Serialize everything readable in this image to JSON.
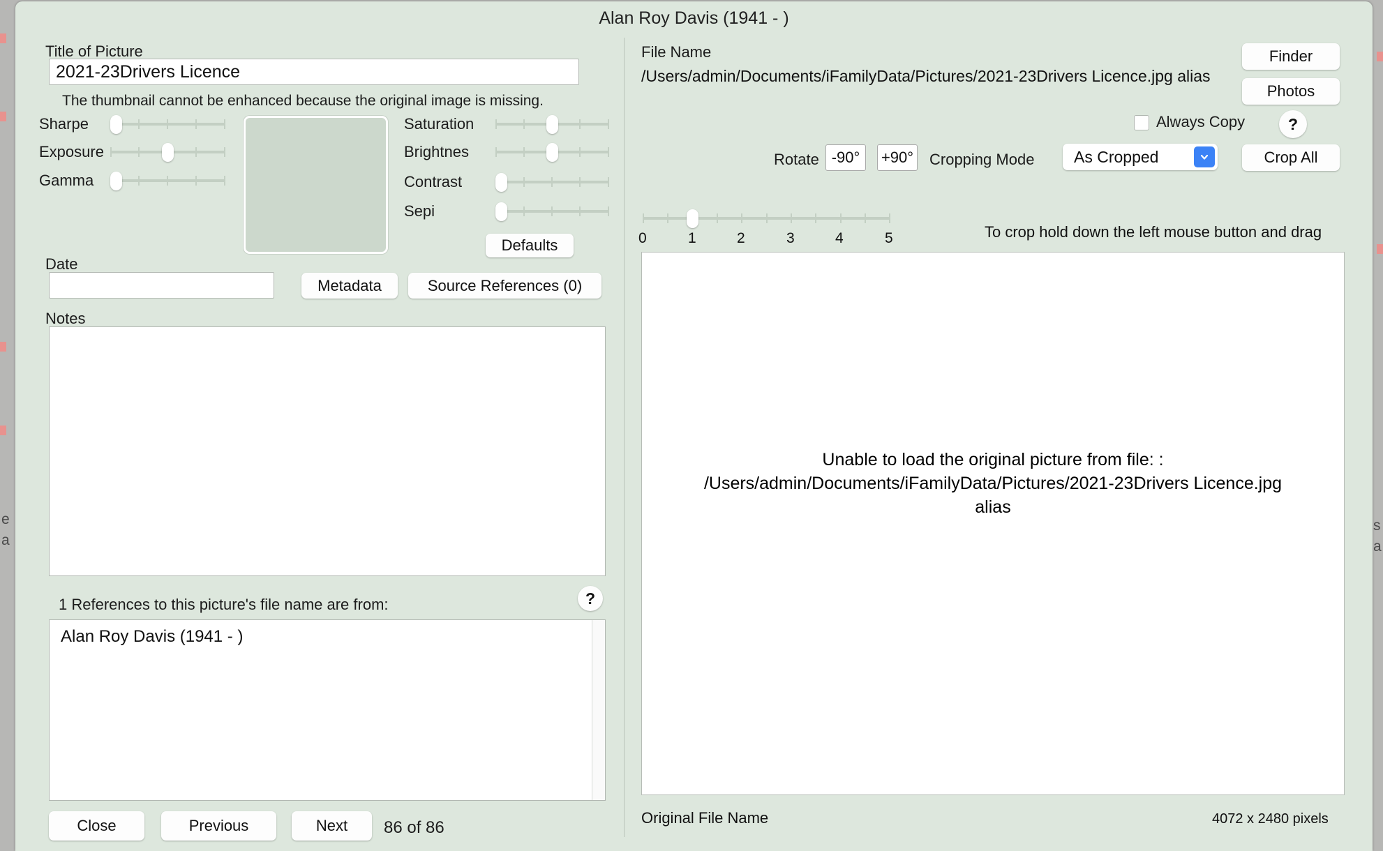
{
  "window": {
    "title": "Alan Roy Davis (1941 - )"
  },
  "background": {
    "snippet1": "e",
    "snippet2": "a",
    "snippet3": "s",
    "snippet4": "a"
  },
  "left": {
    "title_label": "Title of Picture",
    "title_value": "2021-23Drivers Licence",
    "thumbnail_hint": "The thumbnail cannot be enhanced because the original image is missing.",
    "sliders_left": [
      {
        "label": "Sharpe",
        "value": 0
      },
      {
        "label": "Exposure",
        "value": 0.5
      },
      {
        "label": "Gamma",
        "value": 0
      }
    ],
    "sliders_right": [
      {
        "label": "Saturation",
        "value": 0.5
      },
      {
        "label": "Brightnes",
        "value": 0.5
      },
      {
        "label": "Contrast",
        "value": 0
      },
      {
        "label": "Sepi",
        "value": 0
      }
    ],
    "defaults_button": "Defaults",
    "date_label": "Date",
    "date_value": "",
    "metadata_button": "Metadata",
    "source_references_button": "Source References (0)",
    "notes_label": "Notes",
    "notes_value": "",
    "references_label": "1 References to this picture's file name are from:",
    "references_help": "?",
    "references_items": [
      "Alan Roy Davis (1941 - )"
    ],
    "close_button": "Close",
    "previous_button": "Previous",
    "next_button": "Next",
    "counter": "86 of 86"
  },
  "right": {
    "file_name_label": "File Name",
    "file_path": "/Users/admin/Documents/iFamilyData/Pictures/2021-23Drivers Licence.jpg alias",
    "finder_button": "Finder",
    "photos_button": "Photos",
    "always_copy_label": "Always Copy",
    "always_copy_checked": false,
    "help_button": "?",
    "rotate_label": "Rotate",
    "rotate_ccw_button": "-90°",
    "rotate_cw_button": "+90°",
    "cropping_mode_label": "Cropping Mode",
    "cropping_mode_value": "As Cropped",
    "crop_all_button": "Crop All",
    "zoom_slider": {
      "value": 1,
      "min": 0,
      "max": 5,
      "tick_labels": [
        "0",
        "1",
        "2",
        "3",
        "4",
        "5"
      ]
    },
    "crop_instruction": "To crop hold down the left mouse button and drag",
    "image_message_line1": "Unable to load the original picture from file: :",
    "image_message_line2": "/Users/admin/Documents/iFamilyData/Pictures/2021-23Drivers Licence.jpg",
    "image_message_line3": "alias",
    "original_file_name_label": "Original File Name",
    "pixel_dimensions": "4072 x 2480 pixels"
  },
  "colors": {
    "window_bg": "#dde7dd",
    "accent_blue": "#3b82f6",
    "thumbnail_bg": "#ccd8cc",
    "desktop_bg": "#b7b7b5"
  }
}
